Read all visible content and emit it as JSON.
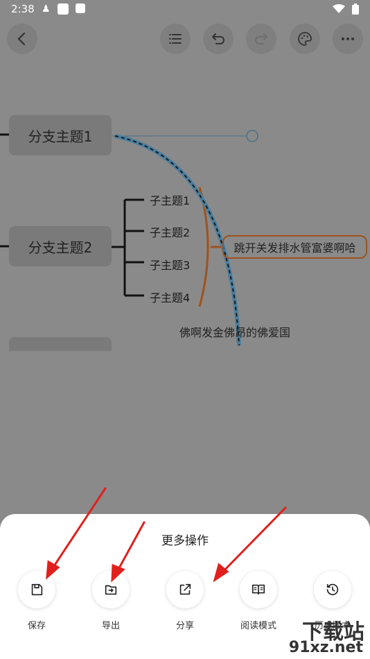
{
  "status": {
    "time": "2:38"
  },
  "icons": {
    "back": "arrow-left-icon",
    "outline": "list-icon",
    "undo": "undo-icon",
    "redo": "redo-icon",
    "theme": "palette-icon",
    "more": "more-icon"
  },
  "mindmap": {
    "branch1": "分支主题1",
    "branch2": "分支主题2",
    "children": [
      "子主题1",
      "子主题2",
      "子主题3",
      "子主题4"
    ],
    "callout": "跳开关发排水管富婆啊哈",
    "floating": "佛啊发金佛昂的佛爱国"
  },
  "sheet": {
    "title": "更多操作",
    "actions": [
      {
        "label": "保存",
        "icon": "save-icon"
      },
      {
        "label": "导出",
        "icon": "export-icon"
      },
      {
        "label": "分享",
        "icon": "share-icon"
      },
      {
        "label": "阅读模式",
        "icon": "book-icon"
      },
      {
        "label": "历史版本",
        "icon": "history-icon"
      }
    ]
  },
  "watermark": {
    "main": "下载站",
    "sub": "91xz.net"
  },
  "colors": {
    "overlay": "#8a8a8a",
    "callout_border": "#a0521c",
    "curve": "#4a7fa0",
    "arrow": "#e0201c"
  }
}
